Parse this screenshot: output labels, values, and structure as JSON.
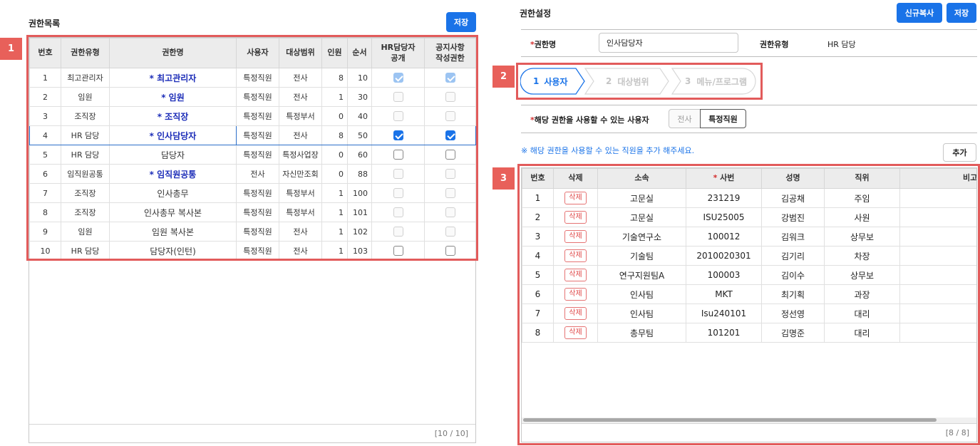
{
  "left": {
    "title": "권한목록",
    "save_label": "저장",
    "headers": [
      "번호",
      "권한유형",
      "권한명",
      "사용자",
      "대상범위",
      "인원",
      "순서",
      "HR담당자 공개",
      "공지사항 작성권한"
    ],
    "rows": [
      {
        "no": "1",
        "type": "최고관리자",
        "name": "* 최고관리자",
        "user": "특정직원",
        "scope": "전사",
        "count": "8",
        "order": "10",
        "hr_public": true,
        "hr_disabled": true,
        "notice": true,
        "notice_disabled": true,
        "blue": true
      },
      {
        "no": "2",
        "type": "임원",
        "name": "* 임원",
        "user": "특정직원",
        "scope": "전사",
        "count": "1",
        "order": "30",
        "hr_public": false,
        "hr_disabled": true,
        "notice": false,
        "notice_disabled": true,
        "blue": true
      },
      {
        "no": "3",
        "type": "조직장",
        "name": "* 조직장",
        "user": "특정직원",
        "scope": "특정부서",
        "count": "0",
        "order": "40",
        "hr_public": false,
        "hr_disabled": true,
        "notice": false,
        "notice_disabled": true,
        "blue": true
      },
      {
        "no": "4",
        "type": "HR 담당",
        "name": "* 인사담당자",
        "user": "특정직원",
        "scope": "전사",
        "count": "8",
        "order": "50",
        "hr_public": true,
        "hr_disabled": false,
        "notice": true,
        "notice_disabled": false,
        "blue": true,
        "selected": true
      },
      {
        "no": "5",
        "type": "HR 담당",
        "name": "담당자",
        "user": "특정직원",
        "scope": "특정사업장",
        "count": "0",
        "order": "60",
        "hr_public": false,
        "hr_disabled": false,
        "notice": false,
        "notice_disabled": false,
        "blue": false
      },
      {
        "no": "6",
        "type": "임직원공통",
        "name": "* 임직원공통",
        "user": "전사",
        "scope": "자신만조회",
        "count": "0",
        "order": "88",
        "hr_public": false,
        "hr_disabled": true,
        "notice": false,
        "notice_disabled": true,
        "blue": true
      },
      {
        "no": "7",
        "type": "조직장",
        "name": "인사총무",
        "user": "특정직원",
        "scope": "특정부서",
        "count": "1",
        "order": "100",
        "hr_public": false,
        "hr_disabled": true,
        "notice": false,
        "notice_disabled": true,
        "blue": false
      },
      {
        "no": "8",
        "type": "조직장",
        "name": "인사총무 복사본",
        "user": "특정직원",
        "scope": "특정부서",
        "count": "1",
        "order": "101",
        "hr_public": false,
        "hr_disabled": true,
        "notice": false,
        "notice_disabled": true,
        "blue": false
      },
      {
        "no": "9",
        "type": "임원",
        "name": "임원 복사본",
        "user": "특정직원",
        "scope": "전사",
        "count": "1",
        "order": "102",
        "hr_public": false,
        "hr_disabled": true,
        "notice": false,
        "notice_disabled": true,
        "blue": false
      },
      {
        "no": "10",
        "type": "HR 담당",
        "name": "담당자(인턴)",
        "user": "특정직원",
        "scope": "전사",
        "count": "1",
        "order": "103",
        "hr_public": false,
        "hr_disabled": false,
        "notice": false,
        "notice_disabled": false,
        "blue": false
      }
    ],
    "footer": "[10 / 10]"
  },
  "right": {
    "title": "권한설정",
    "copy_label": "신규복사",
    "save_label": "저장",
    "name_label": "*권한명",
    "name_value": "인사담당자",
    "type_label": "권한유형",
    "type_value": "HR 담당",
    "steps": [
      {
        "num": "1",
        "label": "사용자",
        "active": true
      },
      {
        "num": "2",
        "label": "대상범위",
        "active": false
      },
      {
        "num": "3",
        "label": "메뉴/프로그램",
        "active": false
      }
    ],
    "user_label": "*해당 권한을 사용할 수 있는 사용자",
    "seg_all": "전사",
    "seg_specific": "특정직원",
    "note": "※ 해당 권한을 사용할 수 있는 직원을 추가 해주세요.",
    "add_label": "추가",
    "headers": [
      "번호",
      "삭제",
      "소속",
      "* 사번",
      "성명",
      "직위",
      "비고"
    ],
    "rows": [
      {
        "no": "1",
        "del": "삭제",
        "dept": "고문실",
        "emp_no": "231219",
        "name": "김공채",
        "position": "주임",
        "note": ""
      },
      {
        "no": "2",
        "del": "삭제",
        "dept": "고문실",
        "emp_no": "ISU25005",
        "name": "강범진",
        "position": "사원",
        "note": ""
      },
      {
        "no": "3",
        "del": "삭제",
        "dept": "기술연구소",
        "emp_no": "100012",
        "name": "김워크",
        "position": "상무보",
        "note": ""
      },
      {
        "no": "4",
        "del": "삭제",
        "dept": "기술팀",
        "emp_no": "2010020301",
        "name": "김기리",
        "position": "차장",
        "note": ""
      },
      {
        "no": "5",
        "del": "삭제",
        "dept": "연구지원팀A",
        "emp_no": "100003",
        "name": "김이수",
        "position": "상무보",
        "note": ""
      },
      {
        "no": "6",
        "del": "삭제",
        "dept": "인사팀",
        "emp_no": "MKT",
        "name": "최기획",
        "position": "과장",
        "note": ""
      },
      {
        "no": "7",
        "del": "삭제",
        "dept": "인사팀",
        "emp_no": "Isu240101",
        "name": "정선영",
        "position": "대리",
        "note": ""
      },
      {
        "no": "8",
        "del": "삭제",
        "dept": "총무팀",
        "emp_no": "101201",
        "name": "김명준",
        "position": "대리",
        "note": ""
      }
    ],
    "footer": "[8 / 8]"
  },
  "callouts": [
    "1",
    "2",
    "3"
  ],
  "colors": {
    "accent": "#1a73e8",
    "highlight": "#e25b5b",
    "auth_name_blue": "#1c2db8",
    "delete_red": "#e04848"
  }
}
